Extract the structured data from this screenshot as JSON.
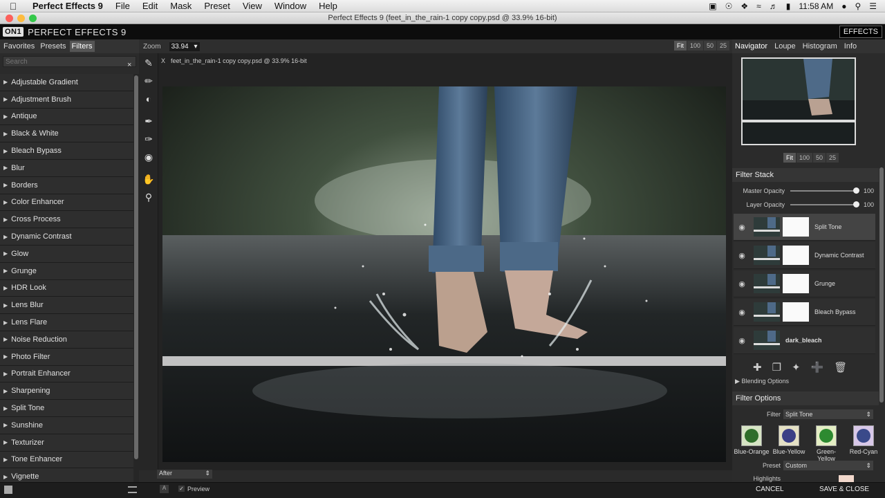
{
  "menubar": {
    "app_name": "Perfect Effects 9",
    "items": [
      "File",
      "Edit",
      "Mask",
      "Preset",
      "View",
      "Window",
      "Help"
    ],
    "clock": "11:58 AM"
  },
  "window": {
    "title": "Perfect Effects 9 (feet_in_the_rain-1 copy copy.psd @ 33.9% 16-bit)"
  },
  "appbar": {
    "logo_mark": "ON1",
    "product": "PERFECT EFFECTS 9",
    "mode_button": "EFFECTS"
  },
  "left_panel": {
    "tabs": [
      "Favorites",
      "Presets",
      "Filters"
    ],
    "active_tab": "Filters",
    "search_placeholder": "Search",
    "filters": [
      "Adjustable Gradient",
      "Adjustment Brush",
      "Antique",
      "Black & White",
      "Bleach Bypass",
      "Blur",
      "Borders",
      "Color Enhancer",
      "Cross Process",
      "Dynamic Contrast",
      "Glow",
      "Grunge",
      "HDR Look",
      "Lens Blur",
      "Lens Flare",
      "Noise Reduction",
      "Photo Filter",
      "Portrait Enhancer",
      "Sharpening",
      "Split Tone",
      "Sunshine",
      "Texturizer",
      "Tone Enhancer",
      "Vignette"
    ]
  },
  "center": {
    "zoom_label": "Zoom",
    "zoom_value": "33.94",
    "view_buttons": [
      "Fit",
      "100",
      "50",
      "25"
    ],
    "doc_tab_close": "X",
    "doc_tab_name": "feet_in_the_rain-1 copy copy.psd @ 33.9% 16-bit",
    "compare_mode": "After",
    "preview_label": "Preview"
  },
  "right_panel": {
    "tabs": [
      "Navigator",
      "Loupe",
      "Histogram",
      "Info"
    ],
    "active_tab": "Navigator",
    "nav_buttons": [
      "Fit",
      "100",
      "50",
      "25"
    ],
    "filter_stack_title": "Filter Stack",
    "master_opacity_label": "Master Opacity",
    "master_opacity_value": "100",
    "layer_opacity_label": "Layer Opacity",
    "layer_opacity_value": "100",
    "layers": [
      "Split Tone",
      "Dynamic Contrast",
      "Grunge",
      "Bleach Bypass",
      "dark_bleach"
    ],
    "blending_options": "Blending Options",
    "filter_options_title": "Filter Options",
    "filter_label": "Filter",
    "filter_value": "Split Tone",
    "preset_label": "Preset",
    "preset_value": "Custom",
    "highlights_label": "Highlights",
    "presets": [
      {
        "name": "Blue-Orange",
        "color": "#2f6e2a"
      },
      {
        "name": "Blue-Yellow",
        "color": "#3b3f86"
      },
      {
        "name": "Green-Yellow",
        "color": "#2d8a30"
      },
      {
        "name": "Red-Cyan",
        "color": "#3a4a8a"
      }
    ]
  },
  "footer": {
    "cancel": "CANCEL",
    "save_close": "SAVE & CLOSE"
  }
}
